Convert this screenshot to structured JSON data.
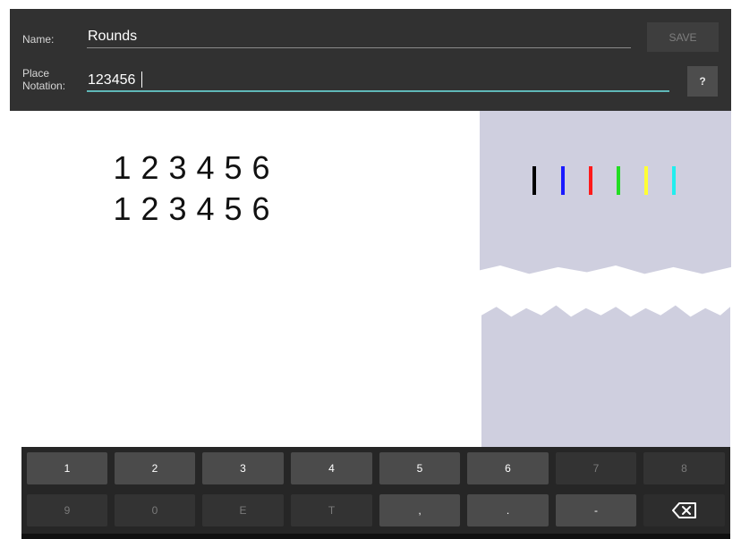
{
  "form": {
    "name_label": "Name:",
    "name_value": "Rounds",
    "place_label_line1": "Place",
    "place_label_line2": "Notation:",
    "place_value": "123456",
    "save_label": "SAVE",
    "help_label": "?"
  },
  "rows": [
    [
      "1",
      "2",
      "3",
      "4",
      "5",
      "6"
    ],
    [
      "1",
      "2",
      "3",
      "4",
      "5",
      "6"
    ]
  ],
  "bell_colors": [
    "#000000",
    "#1a1aff",
    "#ff1a1a",
    "#22dd22",
    "#ffff33",
    "#22eeee"
  ],
  "keyboard": {
    "row1": [
      {
        "label": "1",
        "enabled": true
      },
      {
        "label": "2",
        "enabled": true
      },
      {
        "label": "3",
        "enabled": true
      },
      {
        "label": "4",
        "enabled": true
      },
      {
        "label": "5",
        "enabled": true
      },
      {
        "label": "6",
        "enabled": true
      },
      {
        "label": "7",
        "enabled": false
      },
      {
        "label": "8",
        "enabled": false
      }
    ],
    "row2": [
      {
        "label": "9",
        "enabled": false
      },
      {
        "label": "0",
        "enabled": false
      },
      {
        "label": "E",
        "enabled": false
      },
      {
        "label": "T",
        "enabled": false
      },
      {
        "label": ",",
        "enabled": true
      },
      {
        "label": ".",
        "enabled": true
      },
      {
        "label": "-",
        "enabled": true
      }
    ],
    "backspace_icon": "backspace-icon"
  },
  "colors": {
    "header_bg": "#313131",
    "accent_underline": "#5fb8b8",
    "side_panel": "#cfcfdf"
  }
}
